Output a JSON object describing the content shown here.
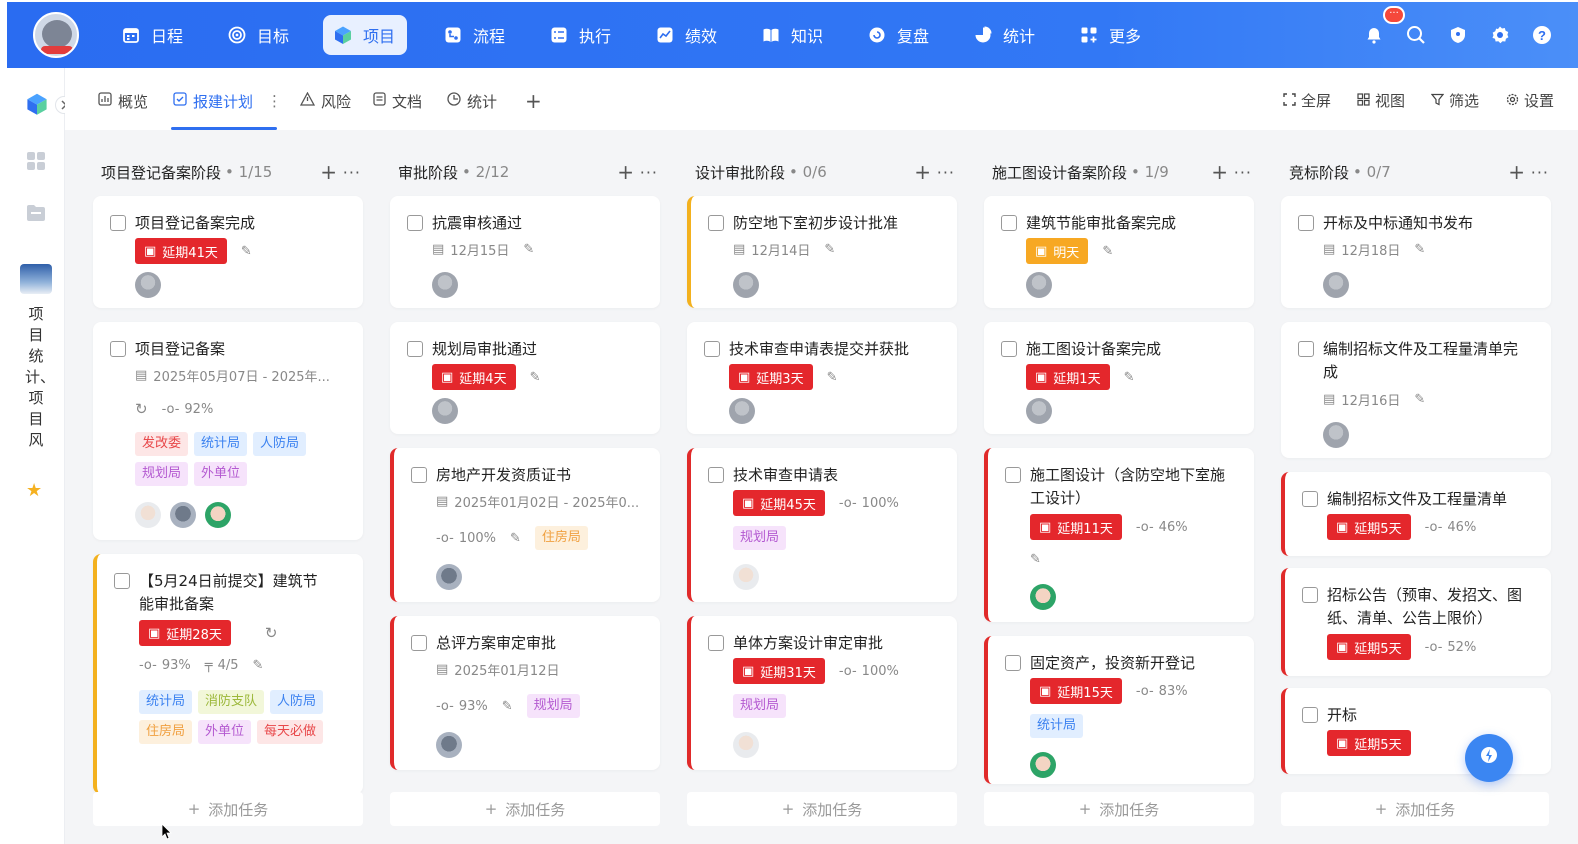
{
  "nav": {
    "items": [
      {
        "label": "日程",
        "icon": "calendar-icon"
      },
      {
        "label": "目标",
        "icon": "target-icon"
      },
      {
        "label": "项目",
        "icon": "cube-icon",
        "active": true
      },
      {
        "label": "流程",
        "icon": "flow-icon"
      },
      {
        "label": "执行",
        "icon": "checklist-icon"
      },
      {
        "label": "绩效",
        "icon": "performance-icon"
      },
      {
        "label": "知识",
        "icon": "book-icon"
      },
      {
        "label": "复盘",
        "icon": "review-icon"
      },
      {
        "label": "统计",
        "icon": "pie-chart-icon"
      },
      {
        "label": "更多",
        "icon": "apps-icon"
      }
    ],
    "badge": "···"
  },
  "sidebar": {
    "project_name": "项目统计、项目风",
    "starred": true
  },
  "tabs": {
    "items": [
      {
        "label": "概览"
      },
      {
        "label": "报建计划",
        "active": true
      },
      {
        "label": "风险"
      },
      {
        "label": "文档"
      },
      {
        "label": "统计"
      }
    ],
    "add": "+"
  },
  "toolbar": {
    "fullscreen": "全屏",
    "view": "视图",
    "filter": "筛选",
    "settings": "设置"
  },
  "add_task_label": "添加任务",
  "columns": [
    {
      "title": "项目登记备案阶段",
      "count": "• 1/15",
      "cards": [
        {
          "title": "项目登记备案完成",
          "tag": "延期41天"
        },
        {
          "title": "项目登记备案",
          "date": "2025年05月07日 - 2025年...",
          "progress": "92%",
          "chips": [
            "发改委",
            "统计局",
            "人防局",
            "规划局",
            "外单位"
          ]
        },
        {
          "title": "【5月24日前提交】建筑节能审批备案",
          "tag": "延期28天",
          "progress": "93%",
          "subtasks": "4/5",
          "chips": [
            "统计局",
            "消防支队",
            "人防局",
            "住房局",
            "外单位",
            "每天必做"
          ]
        }
      ]
    },
    {
      "title": "审批阶段",
      "count": "• 2/12",
      "cards": [
        {
          "title": "抗震审核通过",
          "date": "12月15日"
        },
        {
          "title": "规划局审批通过",
          "tag": "延期4天"
        },
        {
          "title": "房地产开发资质证书",
          "date": "2025年01月02日 - 2025年0...",
          "progress": "100%",
          "chips": [
            "住房局"
          ]
        },
        {
          "title": "总评方案审定审批",
          "date": "2025年01月12日",
          "progress": "93%",
          "chips": [
            "规划局"
          ]
        }
      ]
    },
    {
      "title": "设计审批阶段",
      "count": "• 0/6",
      "cards": [
        {
          "title": "防空地下室初步设计批准",
          "date": "12月14日"
        },
        {
          "title": "技术审查申请表提交并获批",
          "tag": "延期3天"
        },
        {
          "title": "技术审查申请表",
          "tag": "延期45天",
          "progress": "100%",
          "chips": [
            "规划局"
          ]
        },
        {
          "title": "单体方案设计审定审批",
          "tag": "延期31天",
          "progress": "100%",
          "chips": [
            "规划局"
          ]
        }
      ]
    },
    {
      "title": "施工图设计备案阶段",
      "count": "• 1/9",
      "cards": [
        {
          "title": "建筑节能审批备案完成",
          "tag": "明天"
        },
        {
          "title": "施工图设计备案完成",
          "tag": "延期1天"
        },
        {
          "title": "施工图设计（含防空地下室施工设计）",
          "tag": "延期11天",
          "progress": "46%"
        },
        {
          "title": "固定资产，投资新开登记",
          "tag": "延期15天",
          "progress": "83%",
          "chips": [
            "统计局"
          ]
        }
      ]
    },
    {
      "title": "竞标阶段",
      "count": "• 0/7",
      "cards": [
        {
          "title": "开标及中标通知书发布",
          "date": "12月18日"
        },
        {
          "title": "编制招标文件及工程量清单完成",
          "date": "12月16日"
        },
        {
          "title": "编制招标文件及工程量清单",
          "tag": "延期5天",
          "progress": "46%"
        },
        {
          "title": "招标公告（预审、发招文、图纸、清单、公告上限价）",
          "tag": "延期5天",
          "progress": "52%"
        },
        {
          "title": "开标",
          "tag": "延期5天"
        }
      ]
    }
  ]
}
